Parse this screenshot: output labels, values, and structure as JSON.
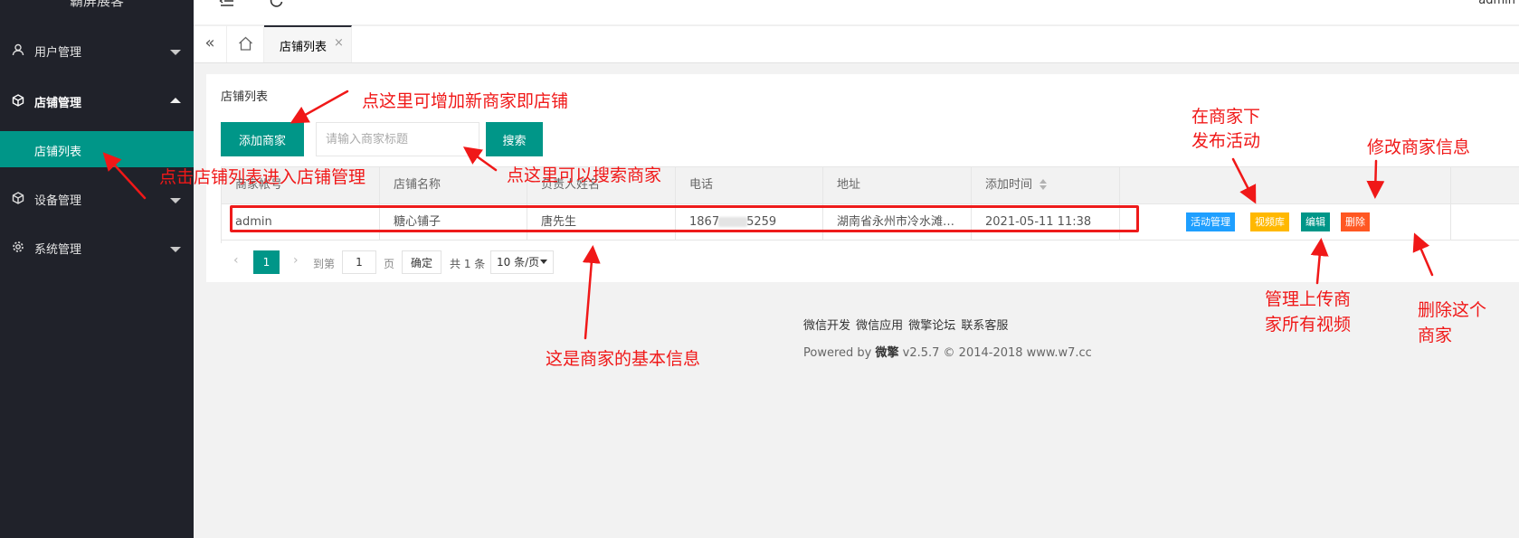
{
  "sidebar": {
    "logo": "霸屏展客",
    "items": [
      {
        "label": "用户管理",
        "icon": "user-icon"
      },
      {
        "label": "店铺管理",
        "icon": "cube-icon"
      },
      {
        "label": "设备管理",
        "icon": "cube-icon"
      },
      {
        "label": "系统管理",
        "icon": "gear-icon"
      }
    ],
    "active_sub": "店铺列表"
  },
  "header": {
    "user": "admin",
    "icons": [
      "menu-fold-icon",
      "refresh-icon"
    ]
  },
  "tabs": {
    "active": "店铺列表",
    "close": "×",
    "collapse": "«"
  },
  "card": {
    "title": "店铺列表",
    "add_button": "添加商家",
    "search_placeholder": "请输入商家标题",
    "search_button": "搜索"
  },
  "table": {
    "columns": [
      "商家帐号",
      "店铺名称",
      "负责人姓名",
      "电话",
      "地址",
      "添加时间"
    ],
    "rows": [
      {
        "account": "admin",
        "shop": "糖心铺子",
        "owner": "唐先生",
        "phone_start": "1867",
        "phone_end": "5259",
        "address": "湖南省永州市冷水滩…",
        "time": "2021-05-11 11:38",
        "ops": [
          "活动管理",
          "视频库",
          "编辑",
          "删除"
        ]
      }
    ]
  },
  "pager": {
    "current": "1",
    "goto_label": "到第",
    "goto_value": "1",
    "page_suffix": "页",
    "confirm": "确定",
    "total": "共 1 条",
    "page_size": "10 条/页"
  },
  "footer": {
    "links": "微信开发 微信应用 微擎论坛 联系客服",
    "powered_prefix": "Powered by ",
    "powered_brand": "微擎",
    "powered_suffix": " v2.5.7 © 2014-2018 www.w7.cc"
  },
  "annotations": {
    "add_shop": "点这里可增加新商家即店铺",
    "shop_list": "点击店铺列表进入店铺管理",
    "search": "点这里可以搜索商家",
    "publish_line1": "在商家下",
    "publish_line2": "发布活动",
    "edit_info": "修改商家信息",
    "basic_info": "这是商家的基本信息",
    "video_line1": "管理上传商",
    "video_line2": "家所有视频",
    "delete_line1": "删除这个",
    "delete_line2": "商家"
  },
  "colors": {
    "sidebar_bg": "#20222a",
    "primary": "#009688",
    "activity_btn": "#1e9fff",
    "video_btn": "#ffb800",
    "edit_btn": "#009688",
    "delete_btn": "#ff5722",
    "annotation": "#f01818"
  }
}
